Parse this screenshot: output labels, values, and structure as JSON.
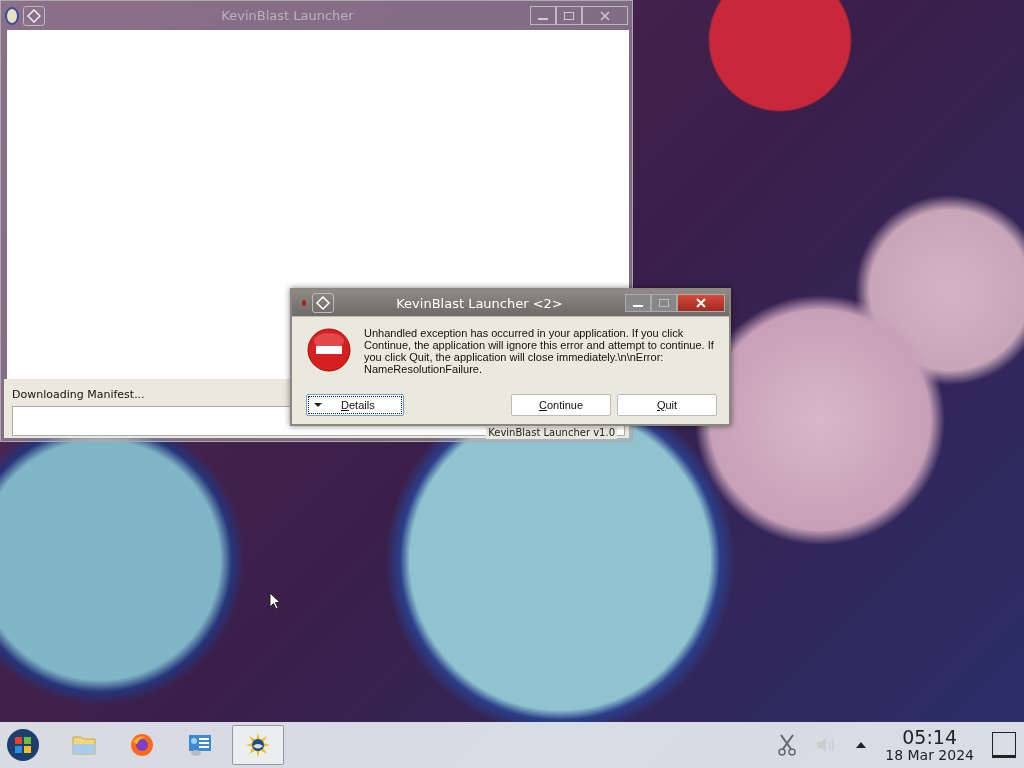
{
  "back_window": {
    "title": "KevinBlast Launcher",
    "status": "Downloading Manifest...",
    "version": "KevinBlast Launcher v1.0"
  },
  "dialog": {
    "title": "KevinBlast Launcher <2>",
    "message": "Unhandled exception has occurred in your application. If you click Continue, the application will ignore this error and attempt to continue. If you click Quit, the application will close immediately.\\n\\nError: NameResolutionFailure.",
    "buttons": [
      {
        "label": "Details",
        "kind": "expander",
        "focused": true
      },
      {
        "label": "Continue",
        "kind": "push",
        "focused": false
      },
      {
        "label": "Quit",
        "kind": "push",
        "focused": false
      }
    ]
  },
  "taskbar": {
    "apps": [
      {
        "kind": "folder",
        "active": false
      },
      {
        "kind": "browser",
        "active": false
      },
      {
        "kind": "settings",
        "active": false
      },
      {
        "kind": "launcher",
        "active": true
      }
    ],
    "time": "05:14",
    "date": "18 Mar 2024"
  }
}
